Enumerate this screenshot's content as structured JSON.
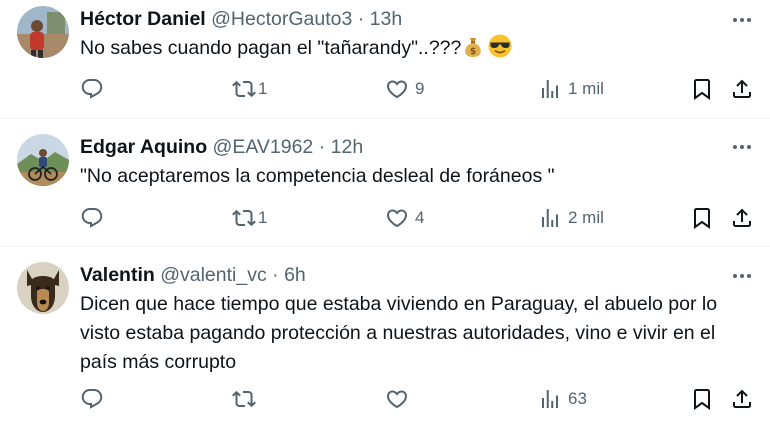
{
  "tweets": [
    {
      "name": "Héctor Daniel",
      "handle": "@HectorGauto3",
      "sep": "·",
      "time": "13h",
      "text": "No sabes cuando pagan el \"tañarandy\"..???",
      "emojis": [
        "money-bag",
        "sunglasses-face"
      ],
      "retweets": "1",
      "likes": "9",
      "views": "1 mil"
    },
    {
      "name": "Edgar Aquino",
      "handle": "@EAV1962",
      "sep": "·",
      "time": "12h",
      "text": "\"No aceptaremos la competencia desleal de foráneos \"",
      "emojis": [],
      "retweets": "1",
      "likes": "4",
      "views": "2 mil"
    },
    {
      "name": "Valentin",
      "handle": "@valenti_vc",
      "sep": "·",
      "time": "6h",
      "text": "Dicen que hace tiempo que estaba viviendo en Paraguay, el abuelo por lo visto estaba pagando protección a nuestras autoridades, vino e vivir en el país más corrupto",
      "emojis": [],
      "retweets": "",
      "likes": "",
      "views": "63"
    }
  ],
  "icons": {
    "reply": "reply-icon",
    "retweet": "retweet-icon",
    "like": "heart-icon",
    "views": "analytics-icon",
    "bookmark": "bookmark-icon",
    "share": "share-icon",
    "more": "more-icon"
  },
  "colors": {
    "text": "#0f1419",
    "secondary": "#536471",
    "divider": "#eff3f4"
  }
}
